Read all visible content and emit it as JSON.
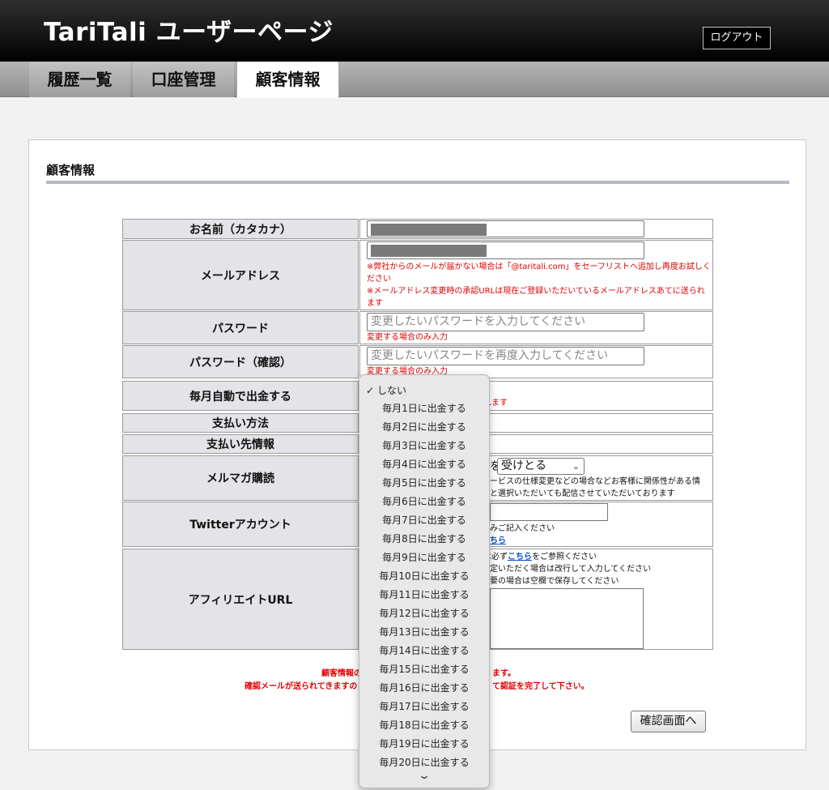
{
  "header": {
    "site_title": "TariTali ユーザーページ",
    "logout_label": "ログアウト"
  },
  "nav": {
    "tabs": [
      {
        "label": "履歴一覧",
        "active": false
      },
      {
        "label": "口座管理",
        "active": false
      },
      {
        "label": "顧客情報",
        "active": true
      }
    ]
  },
  "panel": {
    "title": "顧客情報"
  },
  "form": {
    "rows": [
      {
        "label": "お名前（カタカナ）"
      },
      {
        "label": "メールアドレス"
      },
      {
        "label": "パスワード"
      },
      {
        "label": "パスワード（確認）"
      },
      {
        "label": "毎月自動で出金する"
      },
      {
        "label": "支払い方法"
      },
      {
        "label": "支払い先情報"
      },
      {
        "label": "メルマガ購読"
      },
      {
        "label": "Twitterアカウント"
      },
      {
        "label": "アフィリエイトURL"
      }
    ],
    "email_note_1": "※弊社からのメールが届かない場合は「@taritali.com」をセーフリストへ追加し再度お試しください",
    "email_note_2": "※メールアドレス変更時の承認URLは現在ご登録いただいているメールアドレスあてに送られます",
    "password_placeholder": "変更したいパスワードを入力してください",
    "password_note": "変更する場合のみ入力",
    "password_confirm_placeholder": "変更したいパスワードを再度入力してください",
    "password_confirm_note": "変更する場合のみ入力",
    "auto_withdraw_note_tail": "れます",
    "newsletter_prefix": "を",
    "newsletter_select_value": "受けとる",
    "newsletter_note_1": "ービスの仕様変更などの場合などお客様に関係性がある情",
    "newsletter_note_2": "と選択いただいても配信させていただいております",
    "twitter_note": "みご記入ください",
    "twitter_link": "ちら",
    "affiliate_note_1_pre": "は必ず",
    "affiliate_note_1_link": "こちら",
    "affiliate_note_1_post": "をご参照ください",
    "affiliate_note_2": "定いただく場合は改行して入力してください",
    "affiliate_note_3": "要の場合は空欄で保存してください"
  },
  "footer": {
    "notice_1_left": "顧客情報の",
    "notice_1_right": "ます。",
    "notice_2_left": "確認メールが送られてきますの",
    "notice_2_right": "て認証を完了して下さい。",
    "confirm_button": "確認画面へ"
  },
  "dropdown": {
    "selected_check": "✓",
    "options": [
      "しない",
      "毎月1日に出金する",
      "毎月2日に出金する",
      "毎月3日に出金する",
      "毎月4日に出金する",
      "毎月5日に出金する",
      "毎月6日に出金する",
      "毎月7日に出金する",
      "毎月8日に出金する",
      "毎月9日に出金する",
      "毎月10日に出金する",
      "毎月11日に出金する",
      "毎月12日に出金する",
      "毎月13日に出金する",
      "毎月14日に出金する",
      "毎月15日に出金する",
      "毎月16日に出金する",
      "毎月17日に出金する",
      "毎月18日に出金する",
      "毎月19日に出金する",
      "毎月20日に出金する"
    ],
    "scroll_indicator_icon": "chevron-down-icon"
  }
}
